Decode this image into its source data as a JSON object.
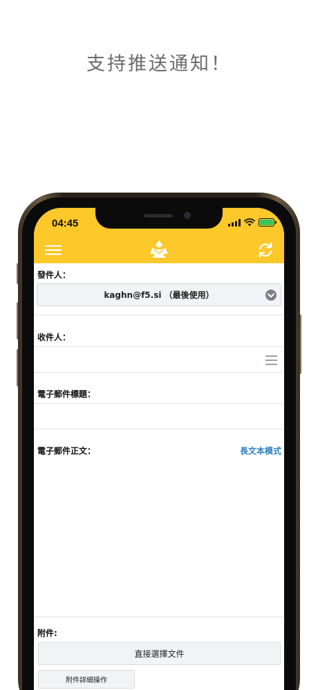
{
  "headline": "支持推送通知！",
  "status_bar": {
    "time": "04:45"
  },
  "app_bar": {
    "menu_icon": "hamburger-icon",
    "logo_icon": "recycle-mail-icon",
    "refresh_icon": "refresh-icon",
    "colors": {
      "bar": "#fcc82a"
    }
  },
  "form": {
    "sender_label": "發件人：",
    "sender_value": "kaghn@f5.si （最後使用）",
    "recipient_label": "收件人：",
    "recipient_value": "",
    "subject_label": "電子郵件標題：",
    "subject_value": "",
    "body_label": "電子郵件正文：",
    "body_mode_link": "長文本模式",
    "body_value": "",
    "attachment_label": "附件:",
    "choose_file_button": "直接選擇文件",
    "attachment_ops_button": "附件詳細操作"
  },
  "colors": {
    "link": "#2f7fc1",
    "accent": "#fcc82a"
  }
}
